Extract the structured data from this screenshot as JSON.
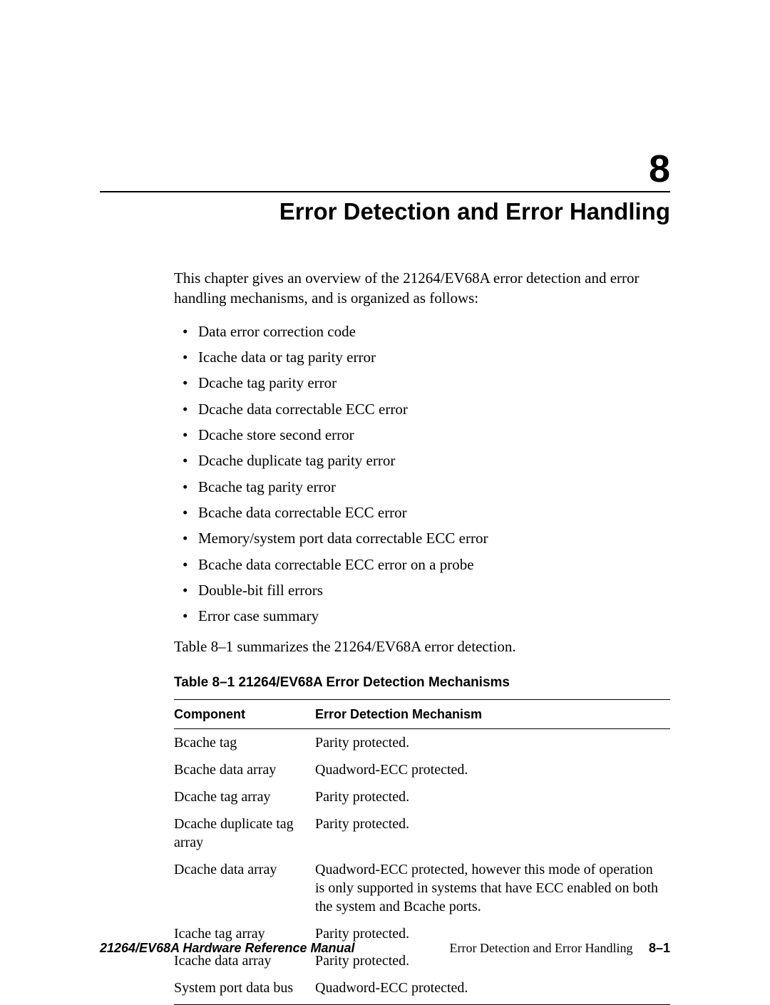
{
  "chapter": {
    "number": "8",
    "title": "Error Detection and Error Handling"
  },
  "intro": "This chapter gives an overview of the 21264/EV68A error detection and error handling mechanisms, and is organized as follows:",
  "bullets": [
    "Data error correction code",
    "Icache data or tag parity error",
    "Dcache tag parity error",
    "Dcache data correctable ECC error",
    "Dcache store second error",
    "Dcache duplicate tag parity error",
    "Bcache tag parity error",
    "Bcache data correctable ECC error",
    "Memory/system port data correctable ECC error",
    "Bcache data correctable ECC error on a probe",
    "Double-bit fill errors",
    "Error case summary"
  ],
  "leadout": "Table 8–1 summarizes the 21264/EV68A error detection.",
  "table": {
    "caption": "Table 8–1  21264/EV68A Error Detection Mechanisms",
    "headers": {
      "component": "Component",
      "mechanism": "Error Detection Mechanism"
    },
    "rows": [
      {
        "component": "Bcache tag",
        "mechanism": "Parity protected."
      },
      {
        "component": "Bcache data array",
        "mechanism": "Quadword-ECC protected."
      },
      {
        "component": "Dcache tag array",
        "mechanism": "Parity protected."
      },
      {
        "component": "Dcache duplicate tag array",
        "mechanism": "Parity protected."
      },
      {
        "component": "Dcache data array",
        "mechanism": "Quadword-ECC protected, however this mode of operation is only supported in systems that have ECC enabled on both the system and Bcache ports."
      },
      {
        "component": "Icache tag array",
        "mechanism": "Parity protected."
      },
      {
        "component": "Icache data array",
        "mechanism": "Parity protected."
      },
      {
        "component": "System port data bus",
        "mechanism": "Quadword-ECC protected."
      }
    ]
  },
  "footer": {
    "left": "21264/EV68A Hardware Reference Manual",
    "right_text": "Error Detection and Error Handling",
    "page": "8–1"
  }
}
